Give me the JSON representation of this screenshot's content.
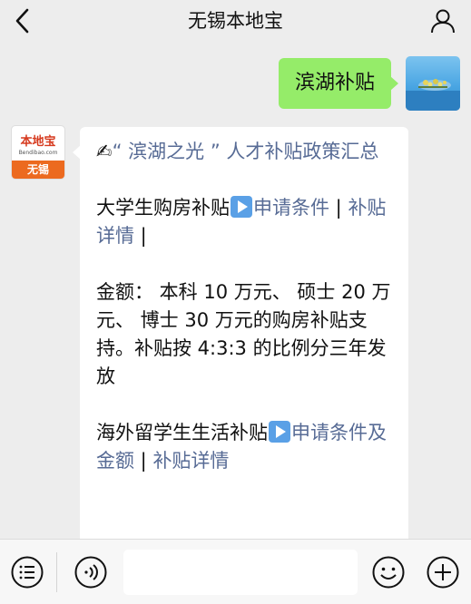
{
  "header": {
    "back_icon": "chevron-left-icon",
    "title": "无锡本地宝",
    "profile_icon": "person-icon"
  },
  "messages": {
    "user_message": "滨湖补贴",
    "bot_avatar": {
      "brand": "本地宝",
      "domain": "Bendibao.com",
      "city": "无锡"
    },
    "bot_reply": {
      "heading_emoji": "✍",
      "heading": "“ 滨湖之光 ” 人才补贴政策汇总",
      "item1_title": "大学生购房补贴",
      "item1_apply_link": "申请条件",
      "sep1": " | ",
      "item1_detail_link": "补贴详情",
      "sep2": " |",
      "amount_text": "金额： 本科 10 万元、 硕士 20 万元、 博士 30 万元的购房补贴支持。补贴按 4:3:3 的比例分三年发放",
      "item2_title": "海外留学生生活补贴",
      "item2_apply_link": "申请条件及金额",
      "sep3": " | ",
      "item2_detail_link": "补贴详情"
    }
  },
  "input_bar": {
    "menu_icon": "menu-list-icon",
    "voice_icon": "voice-icon",
    "text_value": "",
    "emoji_icon": "smiley-icon",
    "plus_icon": "plus-circle-icon"
  },
  "colors": {
    "user_bubble": "#95ec69",
    "link": "#576b95",
    "background": "#ededed"
  }
}
